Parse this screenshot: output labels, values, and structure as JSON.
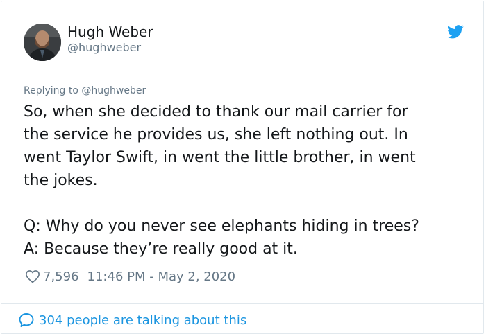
{
  "tweet": {
    "author": {
      "display_name": "Hugh Weber",
      "handle": "@hughweber",
      "avatar_icon": "profile-photo"
    },
    "replying_to": "Replying to @hughweber",
    "text": "So, when she decided to thank our mail carrier for\nthe service he provides us, she left nothing out.  In\nwent Taylor Swift, in went the little brother, in went\nthe jokes.\n\nQ: Why do you never see elephants hiding in trees?\nA: Because they’re really good at it.",
    "likes": "7,596",
    "timestamp": "11:46 PM - May 2, 2020",
    "conversation_link": "304 people are talking about this"
  },
  "icons": {
    "brand": "twitter-bird-icon",
    "like": "heart-icon",
    "conversation": "speech-bubble-icon"
  },
  "colors": {
    "brand_blue": "#1da1f2",
    "link_blue": "#1b95e0",
    "secondary_text": "#657786",
    "border": "#e1e8ed"
  }
}
